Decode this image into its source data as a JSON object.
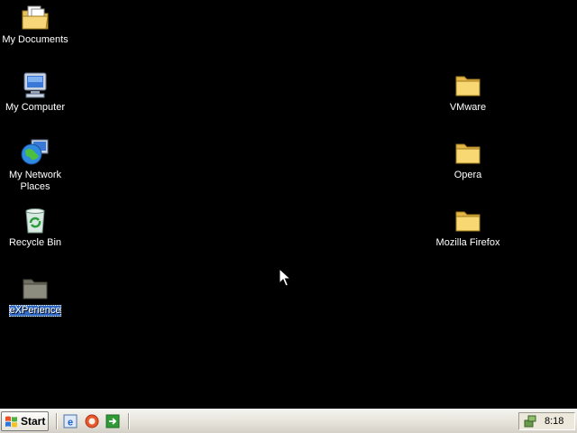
{
  "desktop": {
    "icons": {
      "my_documents": {
        "label": "My Documents",
        "icon": "my-documents-icon"
      },
      "my_computer": {
        "label": "My Computer",
        "icon": "my-computer-icon"
      },
      "my_network_places": {
        "label": "My Network Places",
        "icon": "network-globe-icon"
      },
      "recycle_bin": {
        "label": "Recycle Bin",
        "icon": "recycle-bin-icon"
      },
      "experience": {
        "label": "eXPerience",
        "icon": "folder-icon",
        "selected": true
      },
      "vmware": {
        "label": "VMware",
        "icon": "folder-icon"
      },
      "opera": {
        "label": "Opera",
        "icon": "folder-icon"
      },
      "mozilla_firefox": {
        "label": "Mozilla Firefox",
        "icon": "folder-icon"
      }
    }
  },
  "taskbar": {
    "start_label": "Start",
    "quick_launch": [
      "internet-explorer-icon",
      "browser-icon",
      "show-desktop-icon"
    ],
    "tray": {
      "clock": "8:18",
      "icon": "network-tray-icon"
    }
  },
  "colors": {
    "desktop_background": "#000000",
    "selection": "#316ac5",
    "taskbar": "#ece9dc"
  }
}
